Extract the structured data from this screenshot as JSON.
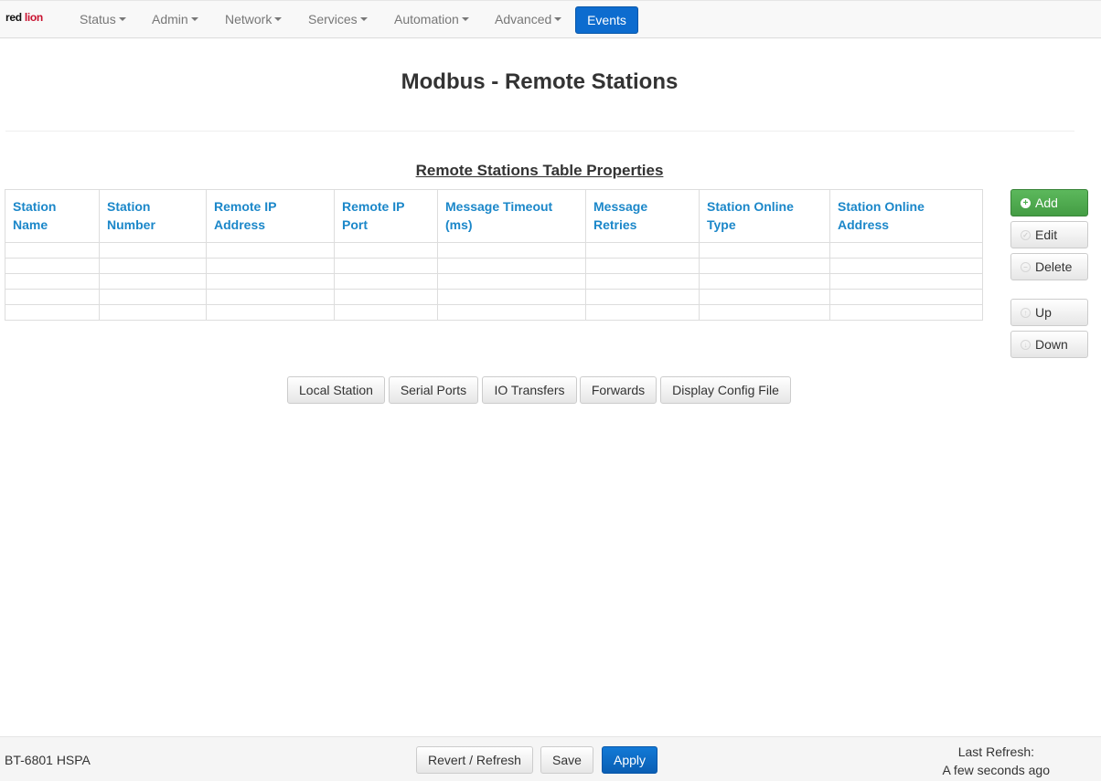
{
  "brand": {
    "logo_text_1": "red ",
    "logo_text_2": "lion"
  },
  "nav": {
    "items": [
      {
        "label": "Status"
      },
      {
        "label": "Admin"
      },
      {
        "label": "Network"
      },
      {
        "label": "Services"
      },
      {
        "label": "Automation"
      },
      {
        "label": "Advanced"
      }
    ],
    "events_label": "Events"
  },
  "page": {
    "title": "Modbus - Remote Stations",
    "section_title": "Remote Stations Table Properties"
  },
  "table": {
    "headers": [
      {
        "line1": "Station",
        "line2": "Name"
      },
      {
        "line1": "Station",
        "line2": "Number"
      },
      {
        "line1": "Remote IP",
        "line2": "Address"
      },
      {
        "line1": "Remote IP",
        "line2": "Port"
      },
      {
        "line1": "Message Timeout",
        "line2": "(ms)"
      },
      {
        "line1": "Message",
        "line2": "Retries"
      },
      {
        "line1": "Station Online",
        "line2": "Type"
      },
      {
        "line1": "Station Online",
        "line2": "Address"
      }
    ]
  },
  "side_buttons": {
    "add": "Add",
    "edit": "Edit",
    "delete": "Delete",
    "up": "Up",
    "down": "Down"
  },
  "nav_buttons": {
    "local_station": "Local Station",
    "serial_ports": "Serial Ports",
    "io_transfers": "IO Transfers",
    "forwards": "Forwards",
    "display_config": "Display Config File"
  },
  "footer": {
    "model": "BT-6801 HSPA",
    "revert_refresh": "Revert / Refresh",
    "save": "Save",
    "apply": "Apply",
    "last_refresh_label": "Last Refresh:",
    "last_refresh_value": "A few seconds ago"
  },
  "colors": {
    "accent_blue": "#0d6ccf",
    "header_link": "#1b87c9",
    "add_green": "#5cb85c"
  }
}
